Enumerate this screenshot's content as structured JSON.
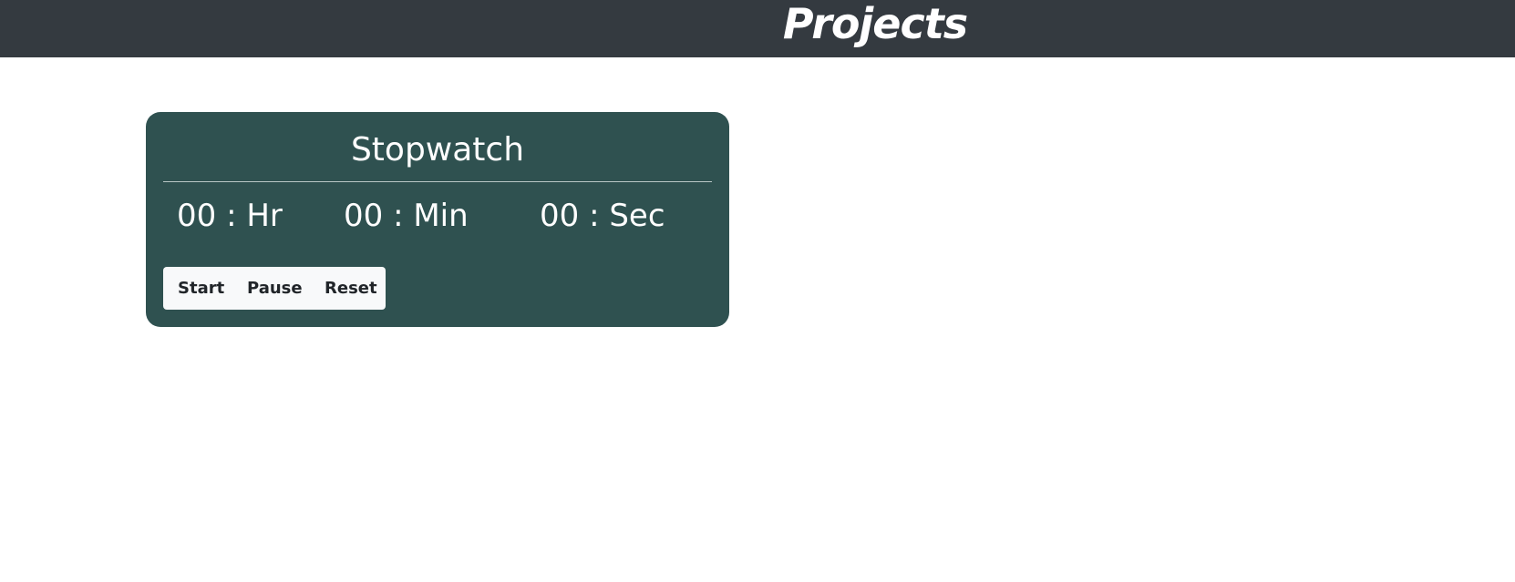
{
  "header": {
    "title": "Projects"
  },
  "stopwatch": {
    "title": "Stopwatch",
    "hours": "00 : Hr",
    "minutes": "00 : Min",
    "seconds": "00 : Sec",
    "buttons": {
      "start": "Start",
      "pause": "Pause",
      "reset": "Reset"
    }
  },
  "colors": {
    "header_bg": "#343a40",
    "card_bg": "#2f5150",
    "button_group_bg": "#f8f9fa"
  }
}
